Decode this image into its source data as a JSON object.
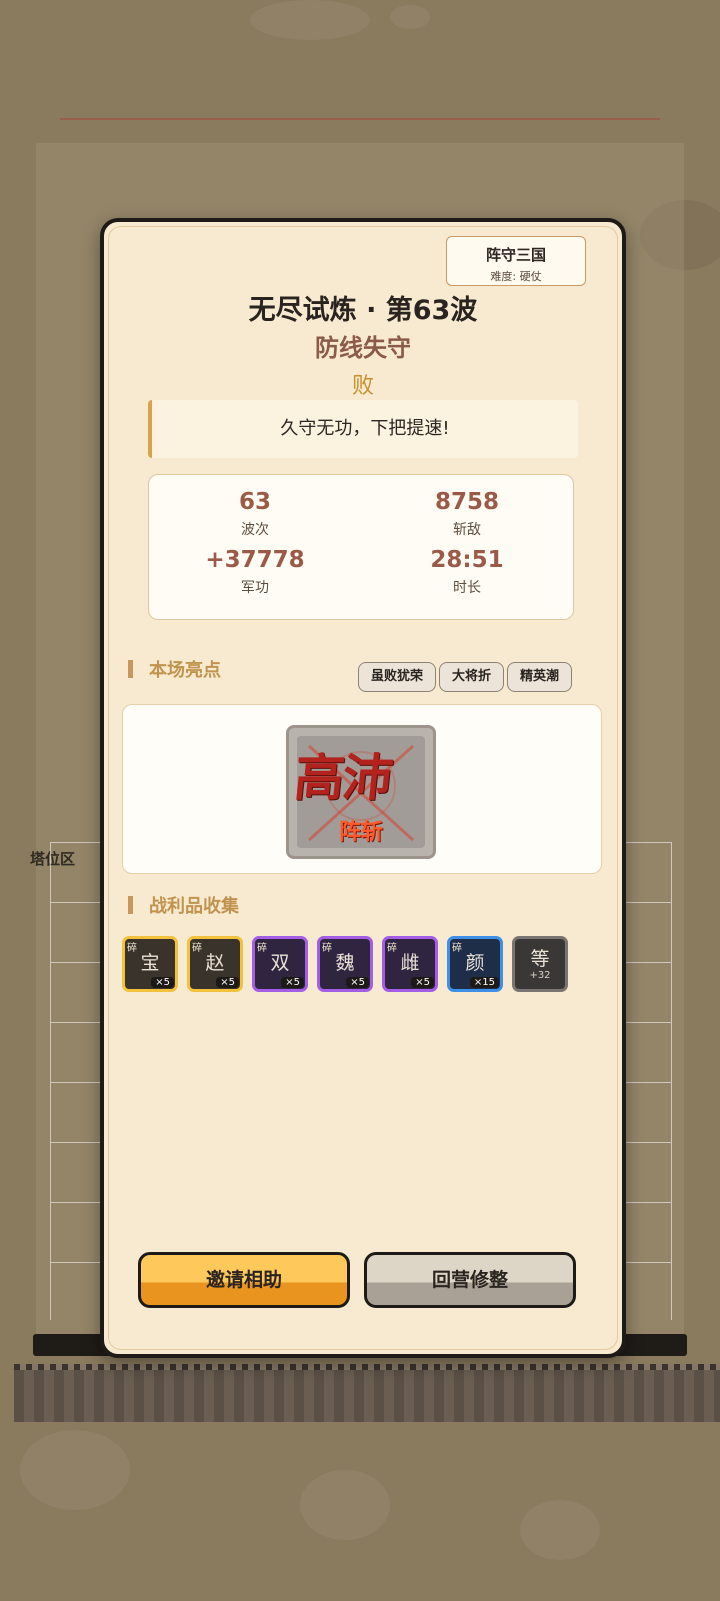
{
  "background": {
    "tower_zone_label": "塔位区"
  },
  "modal": {
    "corner_badge": {
      "name": "阵守三国",
      "difficulty": "难度: 硬仗"
    },
    "title": "无尽试炼 · 第63波",
    "subtitle": "防线失守",
    "result": "败",
    "quote": "久守无功，下把提速!",
    "stats": [
      {
        "value": "63",
        "label": "波次"
      },
      {
        "value": "8758",
        "label": "斩敌"
      },
      {
        "value": "+37778",
        "label": "军功"
      },
      {
        "value": "28:51",
        "label": "时长"
      }
    ],
    "highlights": {
      "heading": "本场亮点",
      "tags": [
        "虽败犹荣",
        "大将折",
        "精英潮"
      ],
      "card": {
        "name": "高沛",
        "tag": "阵斩"
      }
    },
    "loot": {
      "heading": "战利品收集",
      "items": [
        {
          "frag": "碎",
          "char": "宝",
          "count": "×5",
          "rarity": "gold"
        },
        {
          "frag": "碎",
          "char": "赵",
          "count": "×5",
          "rarity": "gold"
        },
        {
          "frag": "碎",
          "char": "双",
          "count": "×5",
          "rarity": "purple"
        },
        {
          "frag": "碎",
          "char": "魏",
          "count": "×5",
          "rarity": "purple"
        },
        {
          "frag": "碎",
          "char": "雌",
          "count": "×5",
          "rarity": "purple"
        },
        {
          "frag": "碎",
          "char": "颜",
          "count": "×15",
          "rarity": "blue"
        },
        {
          "char": "等",
          "more": "+32",
          "rarity": "grey"
        }
      ]
    },
    "buttons": {
      "invite": "邀请相助",
      "return": "回营修整"
    }
  },
  "colors": {
    "modal_bg": "#f7ead0",
    "accent_red": "#9b5a47",
    "accent_gold": "#c0944f",
    "button_primary": "#ffc85a"
  }
}
